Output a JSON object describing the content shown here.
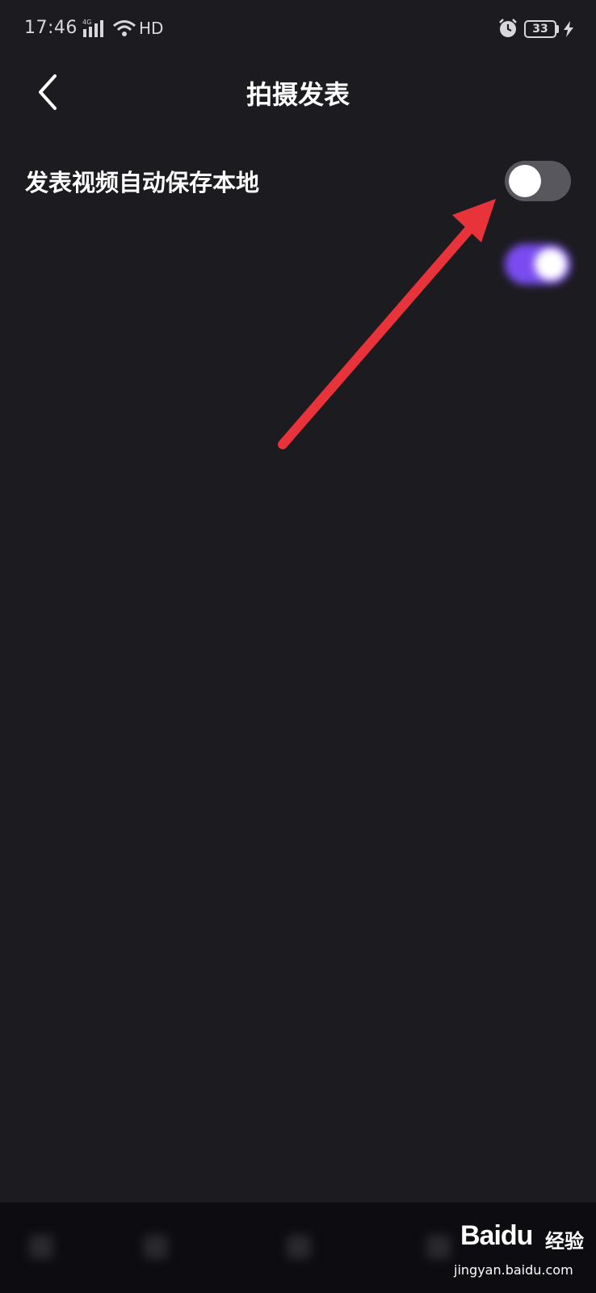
{
  "status_bar": {
    "time": "17:46",
    "network": "4G",
    "hd": "HD",
    "battery": "33",
    "icons": [
      "signal-icon",
      "wifi-icon",
      "alarm-icon",
      "battery-icon",
      "charging-bolt-icon"
    ]
  },
  "nav": {
    "title": "拍摄发表",
    "back_icon": "chevron-left-icon"
  },
  "settings": {
    "save_local": {
      "label": "发表视频自动保存本地",
      "enabled": false
    },
    "blurred_option": {
      "label": "",
      "enabled": true
    },
    "blurred_description": ""
  },
  "annotation": {
    "type": "arrow",
    "color": "#e8333a"
  },
  "watermark": {
    "brand": "Baidu",
    "brand_cn": "经验",
    "url": "jingyan.baidu.com"
  },
  "colors": {
    "background": "#1c1b20",
    "toggle_off": "#57575d",
    "toggle_on": "#7a4cf0",
    "text": "#ffffff"
  }
}
